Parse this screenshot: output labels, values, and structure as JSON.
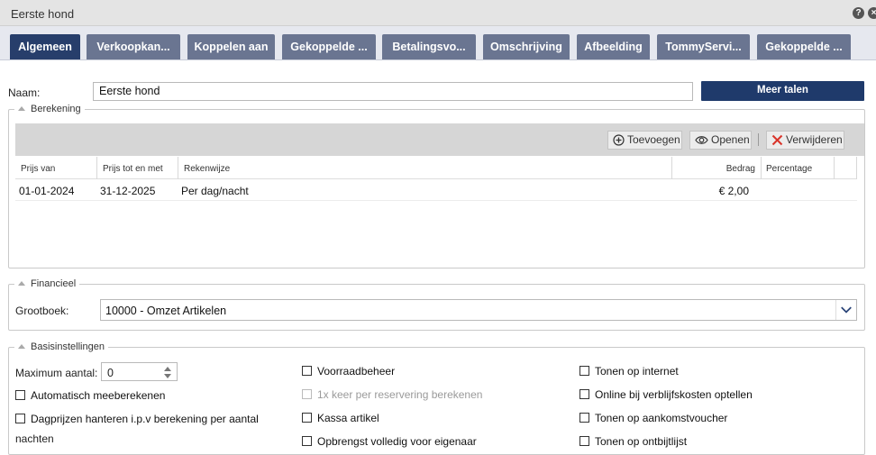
{
  "window": {
    "title": "Eerste hond"
  },
  "tabs": [
    {
      "label": "Algemeen",
      "active": true
    },
    {
      "label": "Verkoopkan..."
    },
    {
      "label": "Koppelen aan"
    },
    {
      "label": "Gekoppelde ..."
    },
    {
      "label": "Betalingsvo..."
    },
    {
      "label": "Omschrijving"
    },
    {
      "label": "Afbeelding"
    },
    {
      "label": "TommyServi..."
    },
    {
      "label": "Gekoppelde ..."
    }
  ],
  "form": {
    "naam_label": "Naam:",
    "naam_value": "Eerste hond",
    "meer_talen": "Meer talen"
  },
  "berekening": {
    "legend": "Berekening",
    "toolbar": {
      "add": "Toevoegen",
      "open": "Openen",
      "delete": "Verwijderen"
    },
    "columns": [
      "Prijs van",
      "Prijs tot en met",
      "Rekenwijze",
      "Bedrag",
      "Percentage"
    ],
    "rows": [
      {
        "prijs_van": "01-01-2024",
        "prijs_tot": "31-12-2025",
        "rekenwijze": "Per dag/nacht",
        "bedrag": "€ 2,00",
        "percentage": ""
      }
    ]
  },
  "financieel": {
    "legend": "Financieel",
    "grootboek_label": "Grootboek:",
    "grootboek_value": "10000 - Omzet Artikelen"
  },
  "basis": {
    "legend": "Basisinstellingen",
    "max_label": "Maximum aantal:",
    "max_value": "0",
    "col1": [
      "Automatisch meeberekenen",
      "Dagprijzen hanteren i.p.v berekening per aantal",
      "nachten"
    ],
    "col2": [
      "Voorraadbeheer",
      "1x keer per reservering berekenen",
      "Kassa artikel",
      "Opbrengst volledig voor eigenaar"
    ],
    "col3": [
      "Tonen op internet",
      "Online bij verblijfskosten optellen",
      "Tonen op aankomstvoucher",
      "Tonen op ontbijtlijst"
    ]
  },
  "colors": {
    "tab": "#6a7591",
    "tab_active": "#273e6b",
    "button_dark": "#1f3a6b"
  }
}
